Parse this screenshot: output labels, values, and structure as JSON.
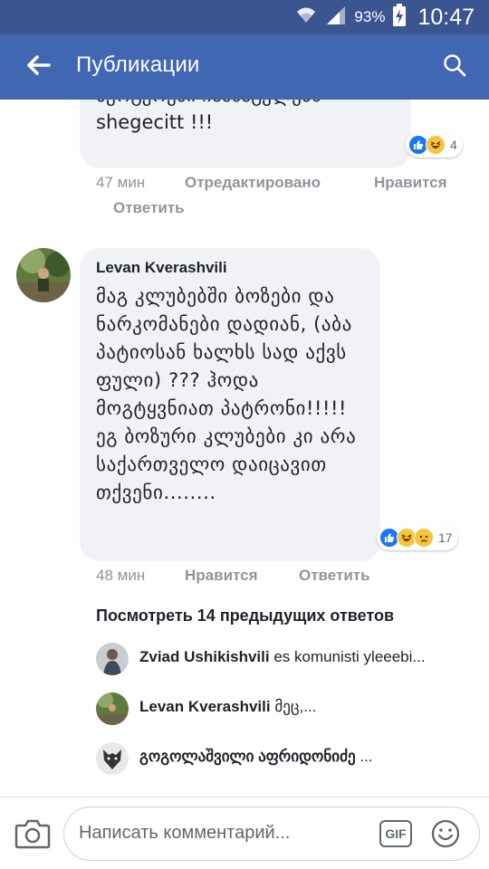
{
  "status_bar": {
    "battery_pct": "93%",
    "time": "10:47",
    "icons": [
      "wifi-icon",
      "signal-icon",
      "battery-icon"
    ]
  },
  "app_bar": {
    "title": "Публикации",
    "back_icon": "arrow-left-icon",
    "search_icon": "search-icon"
  },
  "comments": [
    {
      "text_cut": "ტ",
      "text": "ბურგერები ჩაანაცვლებს shegecitt !!!",
      "reaction_icons": [
        "like-icon",
        "haha-icon"
      ],
      "reaction_count": "4",
      "time": "47 мин",
      "actions": {
        "edited": "Отредактировано",
        "like": "Нравится",
        "reply": "Ответить"
      }
    },
    {
      "author": "Levan Kverashvili",
      "text": "მაგ კლუბებში ბოზები და ნარკომანები დადიან, (აბა პატიოსან ხალხს სად აქვს ფული) ??? ჰოდა მოგტყვნიათ პატრონი!!!!!  ეგ ბოზური კლუბები კი არა საქართველო დაიცავით თქვენი........",
      "reaction_icons": [
        "like-icon",
        "haha-icon",
        "sad-icon"
      ],
      "reaction_count": "17",
      "time": "48 мин",
      "actions": {
        "like": "Нравится",
        "reply": "Ответить"
      }
    }
  ],
  "previous_replies_label": "Посмотреть 14 предыдущих ответов",
  "replies": [
    {
      "author": "Zviad Ushikishvili",
      "text": "es komunisti yleeebi..."
    },
    {
      "author": "Levan Kverashvili",
      "text": "მეც,..."
    },
    {
      "author": "გოგოლაშვილი აფრიდონიძე",
      "text": "..."
    }
  ],
  "composer": {
    "placeholder": "Написать комментарий...",
    "gif_label": "GIF",
    "camera_icon": "camera-icon",
    "emoji_icon": "smiley-icon"
  },
  "colors": {
    "status_bar": "#3a5590",
    "app_bar": "#4267b2",
    "bubble": "#f0f2f5",
    "meta_text": "#90949c"
  }
}
